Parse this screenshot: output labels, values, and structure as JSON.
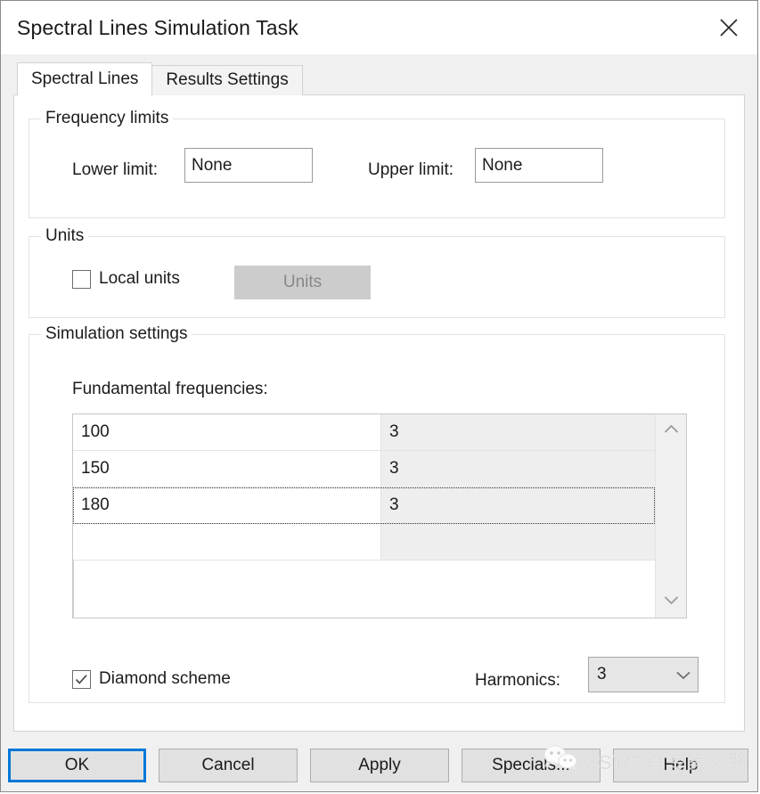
{
  "window": {
    "title": "Spectral Lines Simulation Task",
    "close_icon": "close-icon"
  },
  "tabs": [
    {
      "label": "Spectral Lines",
      "active": true
    },
    {
      "label": "Results Settings",
      "active": false
    }
  ],
  "frequency_limits": {
    "group_title": "Frequency limits",
    "lower_label": "Lower limit:",
    "lower_value": "None",
    "lower_placeholder": "None",
    "upper_label": "Upper limit:",
    "upper_value": "None",
    "upper_placeholder": "None"
  },
  "units": {
    "group_title": "Units",
    "local_units_label": "Local units",
    "local_units_checked": false,
    "button_label": "Units",
    "button_enabled": false
  },
  "simulation_settings": {
    "group_title": "Simulation settings",
    "fundamental_label": "Fundamental frequencies:",
    "table": {
      "rows": [
        {
          "frequency": "100",
          "order": "3",
          "selected": false
        },
        {
          "frequency": "150",
          "order": "3",
          "selected": false
        },
        {
          "frequency": "180",
          "order": "3",
          "selected": true
        },
        {
          "frequency": "",
          "order": "",
          "selected": false
        }
      ],
      "scroll_up_icon": "chevron-up-icon",
      "scroll_down_icon": "chevron-down-icon"
    },
    "diamond_label": "Diamond scheme",
    "diamond_checked": true,
    "harmonics_label": "Harmonics:",
    "harmonics_value": "3",
    "harmonics_arrow_icon": "chevron-down-icon"
  },
  "footer": {
    "ok": "OK",
    "cancel": "Cancel",
    "apply": "Apply",
    "specials": "Specials...",
    "help": "Help"
  },
  "watermark": {
    "text": "CST仿真专家之路",
    "logo_icon": "wechat-icon"
  },
  "colors": {
    "accent_focus": "#0078d7",
    "dialog_bg": "#f0f0f0",
    "panel_bg": "#ffffff",
    "disabled_btn": "#cccccc",
    "table_col2_bg": "#eeeeee"
  }
}
